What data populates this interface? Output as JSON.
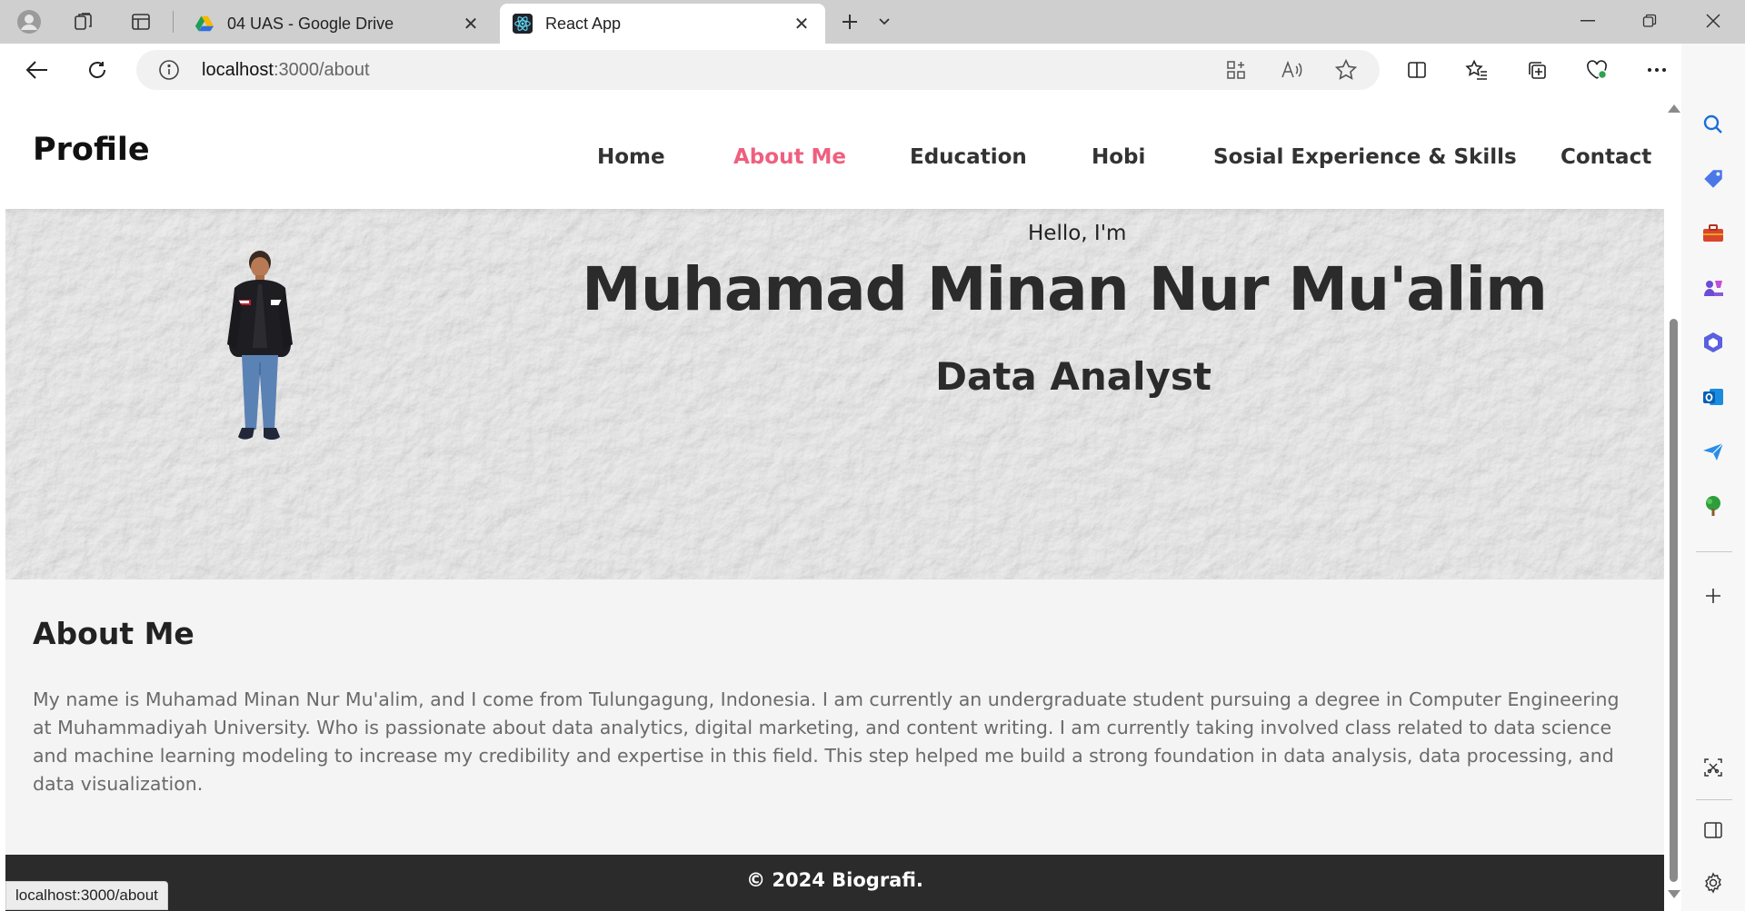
{
  "browser": {
    "tabs": [
      {
        "title": "04 UAS - Google Drive",
        "favicon": "google-drive-icon",
        "active": false
      },
      {
        "title": "React App",
        "favicon": "react-icon",
        "active": true
      }
    ],
    "address": {
      "host": "localhost",
      "path": ":3000/about"
    },
    "status_url": "localhost:3000/about"
  },
  "site": {
    "logo": "Profile",
    "nav": [
      {
        "label": "Home",
        "active": false
      },
      {
        "label": "About Me",
        "active": true
      },
      {
        "label": "Education",
        "active": false
      },
      {
        "label": "Hobi",
        "active": false
      },
      {
        "label": "Sosial Experience & Skills",
        "active": false
      },
      {
        "label": "Contact",
        "active": false
      }
    ],
    "hero": {
      "greeting": "Hello, I'm",
      "name": "Muhamad Minan Nur Mu'alim",
      "role": "Data Analyst"
    },
    "about": {
      "title": "About Me",
      "text": "My name is Muhamad Minan Nur Mu'alim, and I come from Tulungagung, Indonesia. I am currently an undergraduate student pursuing a degree in Computer Engineering at Muhammadiyah University. Who is passionate about data analytics, digital marketing, and content writing. I am currently taking involved class related to data science and machine learning modeling to increase my credibility and expertise in this field. This step helped me build a strong foundation in data analysis, data processing, and data visualization."
    },
    "footer": "© 2024 Biografi."
  },
  "colors": {
    "accent": "#ef5f7e",
    "footer_bg": "#2b2b2b",
    "text_dark": "#222222",
    "text_muted": "#6a6a6a"
  }
}
